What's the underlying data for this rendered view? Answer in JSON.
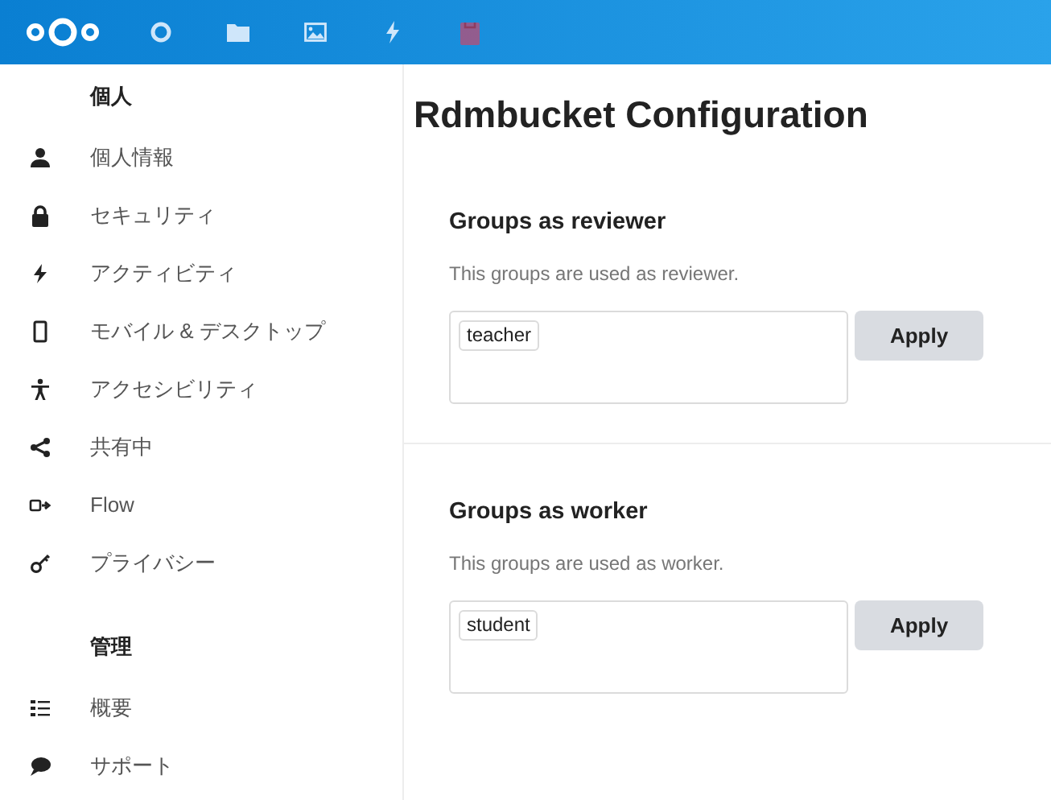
{
  "header": {
    "apps": [
      {
        "kind": "logo"
      },
      {
        "kind": "circle"
      },
      {
        "kind": "folder"
      },
      {
        "kind": "image"
      },
      {
        "kind": "bolt"
      },
      {
        "kind": "bag"
      }
    ]
  },
  "sidebar": {
    "sections": [
      {
        "title": "個人",
        "items": [
          {
            "label": "個人情報",
            "kind": "user"
          },
          {
            "label": "セキュリティ",
            "kind": "lock"
          },
          {
            "label": "アクティビティ",
            "kind": "bolt"
          },
          {
            "label": "モバイル & デスクトップ",
            "kind": "phone"
          },
          {
            "label": "アクセシビリティ",
            "kind": "person"
          },
          {
            "label": "共有中",
            "kind": "share"
          },
          {
            "label": "Flow",
            "kind": "flow"
          },
          {
            "label": "プライバシー",
            "kind": "key"
          }
        ]
      },
      {
        "title": "管理",
        "items": [
          {
            "label": "概要",
            "kind": "list"
          },
          {
            "label": "サポート",
            "kind": "bubble"
          }
        ]
      }
    ]
  },
  "content": {
    "title": "Rdmbucket Configuration",
    "sections": [
      {
        "heading": "Groups as reviewer",
        "description": "This groups are used as reviewer.",
        "tags": [
          "teacher"
        ],
        "button": "Apply"
      },
      {
        "heading": "Groups as worker",
        "description": "This groups are used as worker.",
        "tags": [
          "student"
        ],
        "button": "Apply"
      }
    ]
  }
}
